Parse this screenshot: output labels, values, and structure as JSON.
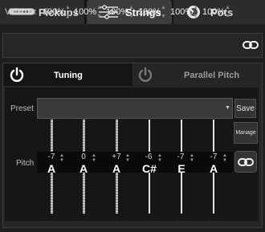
{
  "tabs": {
    "pickups_label": "Pickups",
    "strings_label": "Strings",
    "pots_label": "Pots",
    "active": "Strings"
  },
  "volume": {
    "label": "Volume:",
    "values": [
      "100%",
      "100%",
      "100%",
      "100%",
      "100%",
      "100%"
    ]
  },
  "subtabs": {
    "tuning_label": "Tuning",
    "parallel_pitch_label": "Parallel Pitch",
    "active": "Tuning"
  },
  "preset": {
    "label": "Preset",
    "value": "",
    "save_label": "Save",
    "manage_label": "Manage"
  },
  "pitch": {
    "label": "Pitch",
    "strings": [
      {
        "offset": "-7",
        "note": "A"
      },
      {
        "offset": "0",
        "note": "A"
      },
      {
        "offset": "+7",
        "note": "A"
      },
      {
        "offset": "-6",
        "note": "C#"
      },
      {
        "offset": "-7",
        "note": "E"
      },
      {
        "offset": "-7",
        "note": "A"
      }
    ]
  },
  "icons": {
    "pickups": "pickup-icon",
    "strings": "strings-sliders-icon",
    "pots": "knob-icon",
    "power": "power-icon",
    "link": "chain-link-icon",
    "dropdown": "caret-down-icon"
  },
  "colors": {
    "background": "#1f1f1f",
    "active_tab": "#3c3c3c",
    "inner_panel": "#161616",
    "text": "#ffffff"
  }
}
